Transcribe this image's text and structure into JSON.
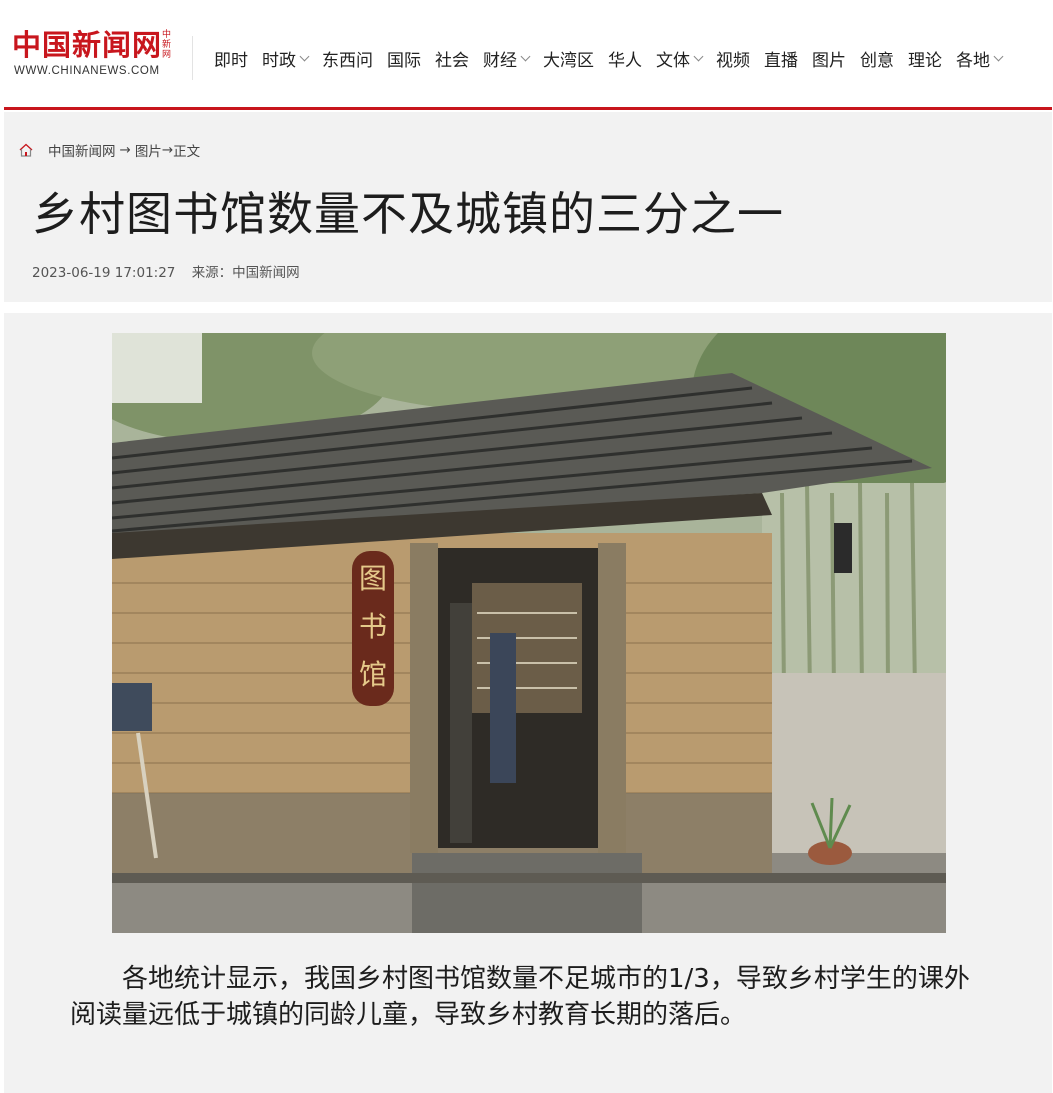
{
  "header": {
    "logo_text": "中国新闻网",
    "logo_side_text": "中新网",
    "logo_url": "WWW.CHINANEWS.COM",
    "nav": [
      {
        "label": "即时",
        "dropdown": false
      },
      {
        "label": "时政",
        "dropdown": true
      },
      {
        "label": "东西问",
        "dropdown": false
      },
      {
        "label": "国际",
        "dropdown": false
      },
      {
        "label": "社会",
        "dropdown": false
      },
      {
        "label": "财经",
        "dropdown": true
      },
      {
        "label": "大湾区",
        "dropdown": false
      },
      {
        "label": "华人",
        "dropdown": false
      },
      {
        "label": "文体",
        "dropdown": true
      },
      {
        "label": "视频",
        "dropdown": false
      },
      {
        "label": "直播",
        "dropdown": false
      },
      {
        "label": "图片",
        "dropdown": false
      },
      {
        "label": "创意",
        "dropdown": false
      },
      {
        "label": "理论",
        "dropdown": false
      },
      {
        "label": "各地",
        "dropdown": true
      }
    ]
  },
  "breadcrumb": {
    "home_icon": "home-icon",
    "site": "中国新闻网",
    "sep1": "→",
    "section": "图片",
    "sep2": "→",
    "current": "正文"
  },
  "article": {
    "title": "乡村图书馆数量不及城镇的三分之一",
    "datetime": "2023-06-19 17:01:27",
    "source": "来源：中国新闻网",
    "photo_sign_text": "图书馆",
    "body": "各地统计显示，我国乡村图书馆数量不足城市的1/3，导致乡村学生的课外阅读量远低于城镇的同龄儿童，导致乡村教育长期的落后。"
  },
  "colors": {
    "brand_red": "#c8161d",
    "panel_bg": "#f2f2f2"
  }
}
